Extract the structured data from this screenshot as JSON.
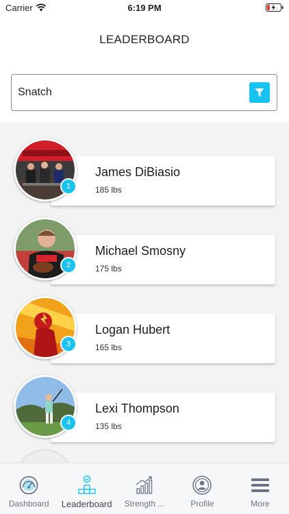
{
  "status_bar": {
    "carrier": "Carrier",
    "time": "6:19 PM"
  },
  "header": {
    "title": "LEADERBOARD"
  },
  "filter": {
    "selected_exercise": "Snatch",
    "icon": "filter-icon"
  },
  "colors": {
    "accent": "#19c3ef",
    "list_background": "#f3f3f3",
    "tab_icon": "#6a7485"
  },
  "leaderboard": [
    {
      "rank": "1",
      "name": "James DiBiasio",
      "weight": "185 lbs"
    },
    {
      "rank": "2",
      "name": "Michael Smosny",
      "weight": "175 lbs"
    },
    {
      "rank": "3",
      "name": "Logan Hubert",
      "weight": "165 lbs"
    },
    {
      "rank": "4",
      "name": "Lexi Thompson",
      "weight": "135 lbs"
    }
  ],
  "tabs": [
    {
      "label": "Dashboard",
      "icon": "dashboard-gauge-icon"
    },
    {
      "label": "Leaderboard",
      "icon": "leaderboard-podium-icon",
      "active": true
    },
    {
      "label": "Strength ...",
      "icon": "strength-chart-icon"
    },
    {
      "label": "Profile",
      "icon": "profile-icon"
    },
    {
      "label": "More",
      "icon": "menu-icon"
    }
  ]
}
